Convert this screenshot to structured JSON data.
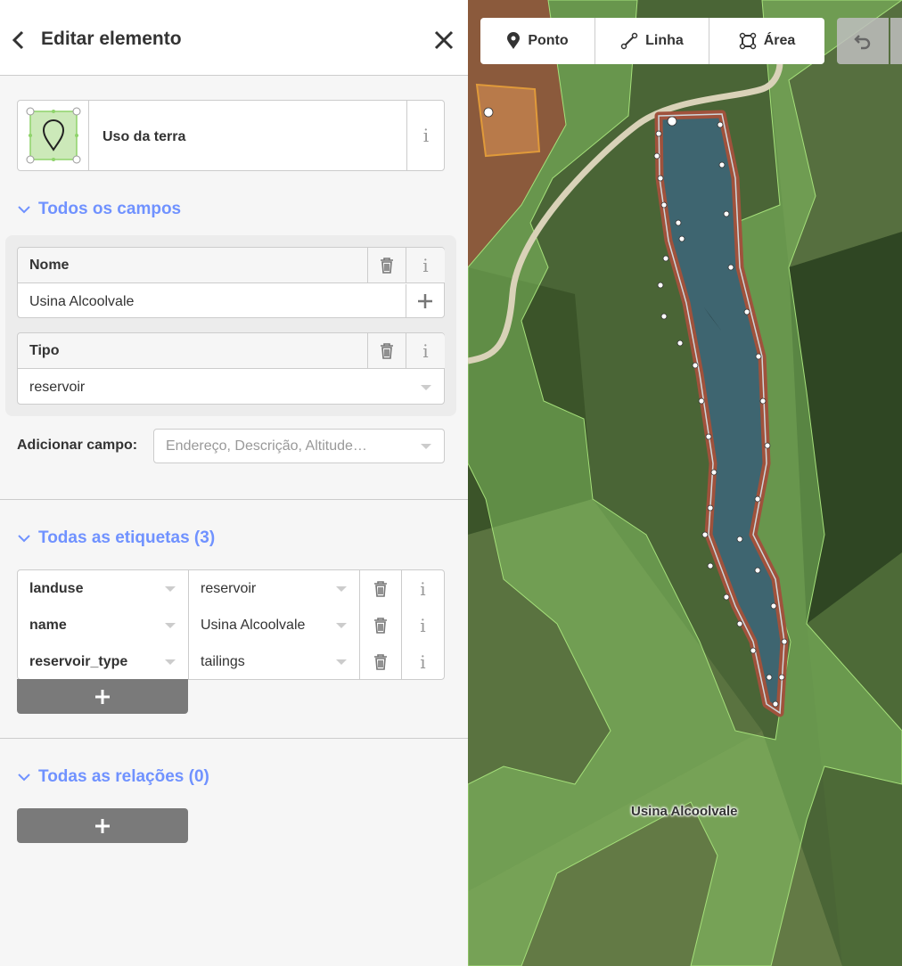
{
  "header": {
    "title": "Editar elemento",
    "back_icon": "chevron-left-icon",
    "close_icon": "close-icon"
  },
  "preset": {
    "name": "Uso da terra",
    "icon": "area-preset-icon",
    "info_glyph": "i"
  },
  "fields_section": {
    "title": "Todos os campos",
    "fields": [
      {
        "label": "Nome",
        "value": "Usina Alcoolvale"
      },
      {
        "label": "Tipo",
        "value": "reservoir"
      }
    ],
    "add_field_label": "Adicionar campo:",
    "add_field_placeholder": "Endereço, Descrição, Altitude…"
  },
  "tags_section": {
    "title": "Todas as etiquetas (3)",
    "tags": [
      {
        "key": "landuse",
        "value": "reservoir"
      },
      {
        "key": "name",
        "value": "Usina Alcoolvale"
      },
      {
        "key": "reservoir_type",
        "value": "tailings"
      }
    ]
  },
  "relations_section": {
    "title": "Todas as relações (0)"
  },
  "toolbar": {
    "point": "Ponto",
    "line": "Linha",
    "area": "Área"
  },
  "map": {
    "label": "Usina Alcoolvale"
  },
  "colors": {
    "accent": "#7092ff",
    "button_gray": "#7a7a7a",
    "water": "#3e6570",
    "landuse_green": "#8fd36b"
  }
}
